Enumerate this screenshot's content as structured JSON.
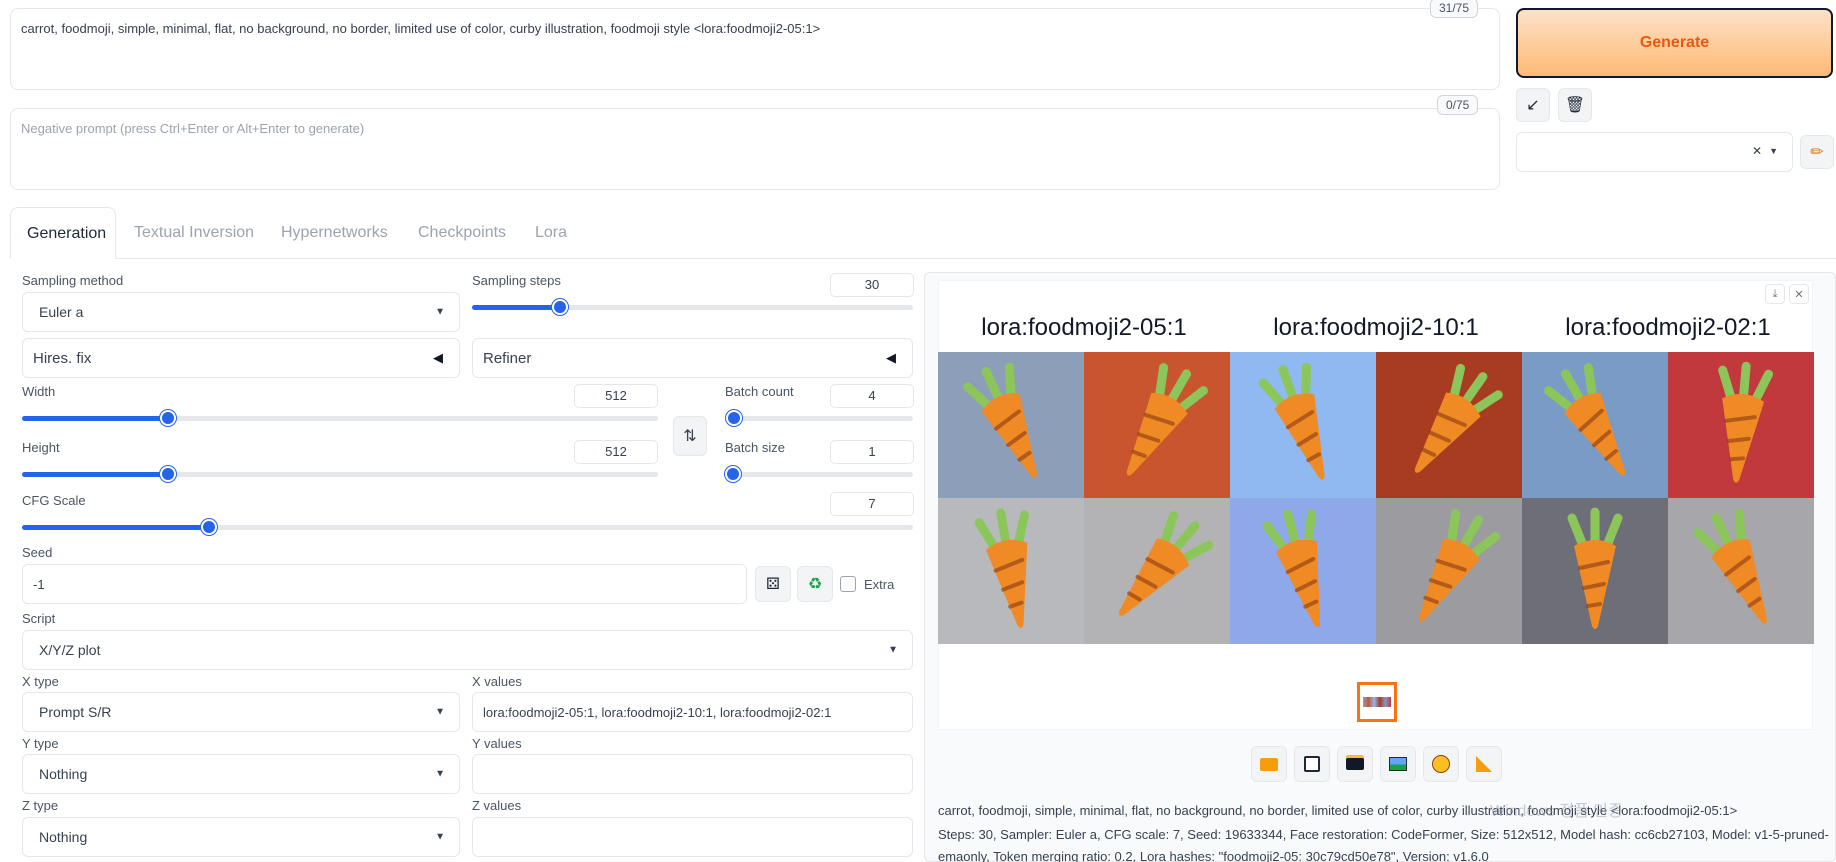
{
  "prompt": {
    "positive_text": "carrot, foodmoji, simple, minimal, flat, no background, no border, limited use of color, curby illustration, foodmoji style  <lora:foodmoji2-05:1>",
    "positive_counter": "31/75",
    "negative_placeholder": "Negative prompt (press Ctrl+Enter or Alt+Enter to generate)",
    "negative_counter": "0/75"
  },
  "actions": {
    "generate_label": "Generate",
    "clear_glyph": "✕"
  },
  "tabs": [
    "Generation",
    "Textual Inversion",
    "Hypernetworks",
    "Checkpoints",
    "Lora"
  ],
  "settings": {
    "sampling_method_label": "Sampling method",
    "sampling_method": "Euler a",
    "sampling_steps_label": "Sampling steps",
    "sampling_steps": "30",
    "sampling_steps_fraction": 0.2,
    "hires_fix": "Hires. fix",
    "refiner": "Refiner",
    "width_label": "Width",
    "width": "512",
    "width_fraction": 0.23,
    "height_label": "Height",
    "height": "512",
    "height_fraction": 0.23,
    "batch_count_label": "Batch count",
    "batch_count": "4",
    "batch_count_fraction": 0.03,
    "batch_size_label": "Batch size",
    "batch_size": "1",
    "batch_size_fraction": 0.0,
    "cfg_label": "CFG Scale",
    "cfg": "7",
    "cfg_fraction": 0.21,
    "seed_label": "Seed",
    "seed": "-1",
    "extra_label": "Extra",
    "script_label": "Script",
    "script": "X/Y/Z plot",
    "x_type_label": "X type",
    "x_type": "Prompt S/R",
    "x_values_label": "X values",
    "x_values": "lora:foodmoji2-05:1, lora:foodmoji2-10:1, lora:foodmoji2-02:1",
    "y_type_label": "Y type",
    "y_type": "Nothing",
    "y_values_label": "Y values",
    "y_values": "",
    "z_type_label": "Z type",
    "z_type": "Nothing",
    "z_values_label": "Z values",
    "z_values": ""
  },
  "gallery": {
    "columns": [
      "lora:foodmoji2-05:1",
      "lora:foodmoji2-10:1",
      "lora:foodmoji2-02:1"
    ],
    "tile_colors": [
      "#8d9fb8",
      "#c9552e",
      "#8fb9f0",
      "#a83c20",
      "#7b9bc7",
      "#c1393d",
      "#b8b9bd",
      "#b3b3b5",
      "#8fa8ea",
      "#9b9ba0",
      "#6e6e78",
      "#a6a6ab"
    ],
    "info_line_1": "carrot, foodmoji, simple, minimal, flat, no background, no border, limited use of color, curby illustration, foodmoji style <lora:foodmoji2-05:1>",
    "info_line_2": "Steps: 30, Sampler: Euler a, CFG scale: 7, Seed: 19633344, Face restoration: CodeFormer, Size: 512x512, Model hash: cc6cb27103, Model: v1-5-pruned-",
    "info_line_3": "emaonly, Token merging ratio: 0.2, Lora hashes: \"foodmoji2-05: 30c79cd50e78\", Version: v1.6.0",
    "watermark": "Windows 정품 인증"
  },
  "icons": {
    "arrow": "↙",
    "trash": "🗑",
    "pencil": "✏",
    "swap": "⇅",
    "dice": "⚄",
    "recycle": "♻",
    "download": "⤓",
    "close": "✕"
  }
}
